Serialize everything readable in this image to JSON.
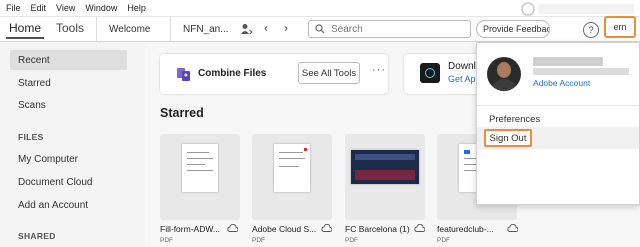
{
  "menubar": [
    "File",
    "Edit",
    "View",
    "Window",
    "Help"
  ],
  "tabs": {
    "home": "Home",
    "tools": "Tools",
    "documents": [
      {
        "label": "Welcome"
      },
      {
        "label": "NFN_an..."
      }
    ],
    "close_glyph": "×"
  },
  "search": {
    "placeholder": "Search"
  },
  "provide_button": "Provide Feedback",
  "help_glyph": "?",
  "signin_label": "ern",
  "sidebar": {
    "items": [
      "Recent",
      "Starred",
      "Scans"
    ],
    "files_header": "FILES",
    "file_items": [
      "My Computer",
      "Document Cloud",
      "Add an Account"
    ],
    "shared_header": "SHARED"
  },
  "cards": {
    "combine_title": "Combine Files",
    "see_all": "See All Tools",
    "more": "···",
    "download_title": "Downl",
    "download_link": "Get Ap"
  },
  "starred": {
    "title": "Starred",
    "files": [
      {
        "name": "Fill-form-ADW...",
        "type": "PDF"
      },
      {
        "name": "Adobe Cloud S...",
        "type": "PDF"
      },
      {
        "name": "FC Barcelona (1)",
        "type": "PDF"
      },
      {
        "name": "featuredclub-...",
        "type": "PDF"
      }
    ]
  },
  "account_menu": {
    "adobe_account": "Adobe Account",
    "preferences": "Preferences",
    "sign_out": "Sign Out"
  },
  "colors": {
    "accent": "#1473e6",
    "highlight": "#e88d3a"
  }
}
